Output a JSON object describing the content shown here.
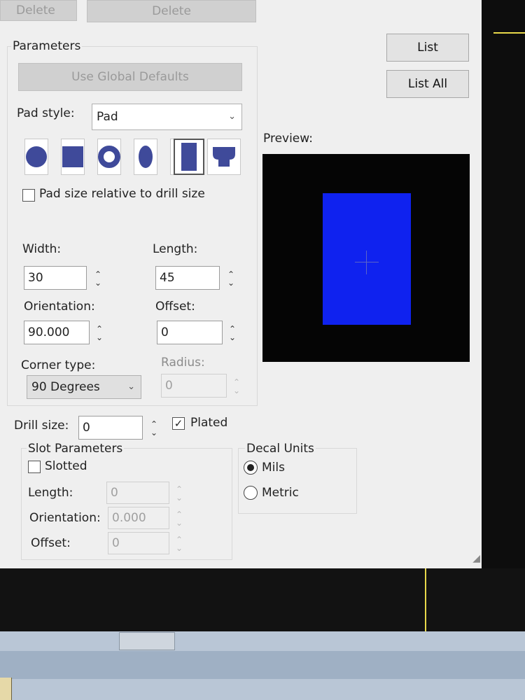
{
  "top_buttons": {
    "delete_left": "Delete",
    "delete_right": "Delete"
  },
  "list_buttons": {
    "list": "List",
    "list_all": "List All"
  },
  "parameters": {
    "group_title": "Parameters",
    "use_global_defaults": "Use Global Defaults",
    "pad_style_label": "Pad style:",
    "pad_style_value": "Pad",
    "pad_size_relative_label": "Pad size relative to drill size",
    "pad_size_relative_checked": false,
    "width_label": "Width:",
    "width_value": "30",
    "length_label": "Length:",
    "length_value": "45",
    "orientation_label": "Orientation:",
    "orientation_value": "90.000",
    "offset_label": "Offset:",
    "offset_value": "0",
    "corner_type_label": "Corner type:",
    "corner_type_value": "90 Degrees",
    "radius_label": "Radius:",
    "radius_value": "0"
  },
  "pad_shapes": [
    "round-icon",
    "square-icon",
    "annulus-icon",
    "oval-icon",
    "finger-icon",
    "rectangle-icon",
    "thermal-icon"
  ],
  "preview": {
    "label": "Preview:",
    "pad_color": "#0f22ef",
    "background_color": "#050505"
  },
  "drill": {
    "drill_size_label": "Drill size:",
    "drill_size_value": "0",
    "plated_label": "Plated",
    "plated_checked": true
  },
  "slot": {
    "group_title": "Slot Parameters",
    "slotted_label": "Slotted",
    "slotted_checked": false,
    "length_label": "Length:",
    "length_value": "0",
    "orientation_label": "Orientation:",
    "orientation_value": "0.000",
    "offset_label": "Offset:",
    "offset_value": "0"
  },
  "decal_units": {
    "group_title": "Decal Units",
    "mils_label": "Mils",
    "metric_label": "Metric",
    "selected": "Mils"
  }
}
